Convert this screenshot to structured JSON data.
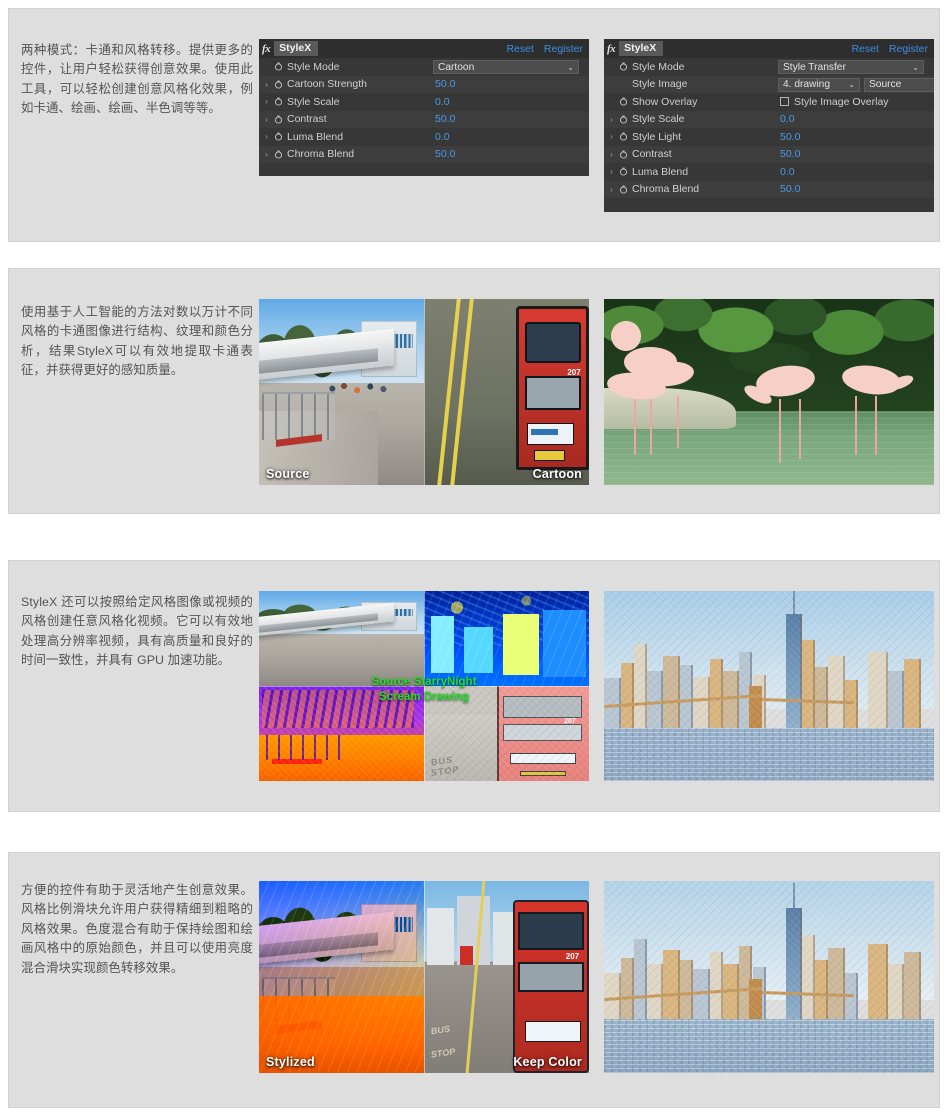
{
  "sections": [
    {
      "id": "modes",
      "description": "两种模式：卡通和风格转移。提供更多的控件，让用户轻松获得创意效果。使用此工具，可以轻松创建创意风格化效果，例如卡通、绘画、绘画、半色调等等。"
    },
    {
      "id": "ai-analysis",
      "description": "使用基于人工智能的方法对数以万计不同风格的卡通图像进行结构、纹理和颜色分析，结果StyleX可以有效地提取卡通表征，并获得更好的感知质量。"
    },
    {
      "id": "style-transfer",
      "description": "StyleX 还可以按照给定风格图像或视频的风格创建任意风格化视频。它可以有效地处理高分辨率视频，具有高质量和良好的时间一致性，并具有 GPU 加速功能。"
    },
    {
      "id": "controls",
      "description": "方便的控件有助于灵活地产生创意效果。风格比例滑块允许用户获得精细到粗略的风格效果。色度混合有助于保持绘图和绘画风格中的原始颜色，并且可以使用亮度混合滑块实现颜色转移效果。"
    }
  ],
  "panels": {
    "cartoon": {
      "fx_glyph": "fx",
      "title": "StyleX",
      "reset_label": "Reset",
      "register_label": "Register",
      "rows": [
        {
          "label": "Style Mode",
          "type": "dropdown",
          "value": "Cartoon",
          "twirl": false,
          "stopwatch": true
        },
        {
          "label": "Cartoon Strength",
          "type": "value",
          "value": "50.0",
          "twirl": true,
          "stopwatch": true
        },
        {
          "label": "Style Scale",
          "type": "value",
          "value": "0.0",
          "twirl": true,
          "stopwatch": true
        },
        {
          "label": "Contrast",
          "type": "value",
          "value": "50.0",
          "twirl": true,
          "stopwatch": true
        },
        {
          "label": "Luma Blend",
          "type": "value",
          "value": "0.0",
          "twirl": true,
          "stopwatch": true
        },
        {
          "label": "Chroma Blend",
          "type": "value",
          "value": "50.0",
          "twirl": true,
          "stopwatch": true
        }
      ]
    },
    "transfer": {
      "fx_glyph": "fx",
      "title": "StyleX",
      "reset_label": "Reset",
      "register_label": "Register",
      "rows": [
        {
          "label": "Style Mode",
          "type": "dropdown",
          "value": "Style Transfer",
          "twirl": false,
          "stopwatch": true
        },
        {
          "label": "Style Image",
          "type": "dropdown2",
          "value": "4. drawing",
          "value2": "Source",
          "twirl": false,
          "stopwatch": false
        },
        {
          "label": "Show Overlay",
          "type": "checkbox",
          "value": "Style Image Overlay",
          "checked": false,
          "twirl": false,
          "stopwatch": true
        },
        {
          "label": "Style Scale",
          "type": "value",
          "value": "0.0",
          "twirl": true,
          "stopwatch": true
        },
        {
          "label": "Style Light",
          "type": "value",
          "value": "50.0",
          "twirl": true,
          "stopwatch": true
        },
        {
          "label": "Contrast",
          "type": "value",
          "value": "50.0",
          "twirl": true,
          "stopwatch": true
        },
        {
          "label": "Luma Blend",
          "type": "value",
          "value": "0.0",
          "twirl": true,
          "stopwatch": true
        },
        {
          "label": "Chroma Blend",
          "type": "value",
          "value": "50.0",
          "twirl": true,
          "stopwatch": true
        }
      ]
    }
  },
  "figures": {
    "row2_left": {
      "caption_left": "Source",
      "caption_right": "Cartoon"
    },
    "row2_right": {
      "caption": ""
    },
    "row3_left": {
      "overlay_line1": "Source  StarryNight",
      "overlay_line2": "Scream  Drawing"
    },
    "row4_left": {
      "caption_left": "Stylized",
      "caption_right": "Keep Color"
    }
  },
  "colors": {
    "section_bg": "#dededf",
    "page_bg": "#ffffff",
    "panel_bg": "#373737",
    "panel_row_alt": "#3d3d3d",
    "panel_header": "#2e2e2e",
    "link_blue": "#3a8ee0",
    "value_blue": "#4a9ae8",
    "label_gray": "#cfcfcf",
    "desc_text": "#545454",
    "overlay_green": "#24e024",
    "caption_white": "#ffffff"
  }
}
